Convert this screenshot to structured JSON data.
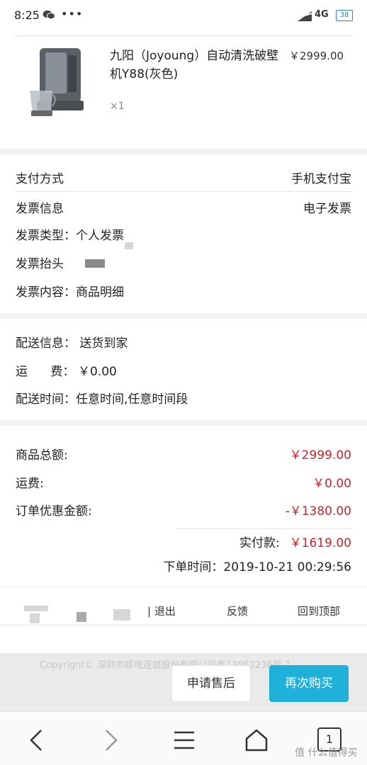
{
  "status_bar": {
    "time": "8:25",
    "more": "•••",
    "network": "4G",
    "battery": "38"
  },
  "product": {
    "name": "九阳（Joyoung）自动清洗破壁机Y88(灰色)",
    "price": "￥2999.00",
    "quantity": "×1"
  },
  "payment": {
    "method_label": "支付方式",
    "method_value": "手机支付宝"
  },
  "invoice": {
    "info_label": "发票信息",
    "info_value": "电子发票",
    "type": "发票类型：个人发票",
    "title_label": "发票抬头",
    "content": "发票内容：商品明细"
  },
  "delivery": {
    "info": "配送信息：  送货到家",
    "fee_label": "运      费：",
    "fee_value": "￥0.00",
    "time": "配送时间：任意时间,任意时间段"
  },
  "summary": {
    "goods_total_label": "商品总额:",
    "goods_total_value": "￥2999.00",
    "shipping_label": "运费:",
    "shipping_value": "￥0.00",
    "discount_label": "订单优惠金额:",
    "discount_value": "-￥1380.00",
    "paid_label": "实付款:",
    "paid_value": "￥1619.00",
    "order_time": "下单时间：2019-10-21 00:29:56"
  },
  "footer": {
    "logout": "| 退出",
    "feedback": "反馈",
    "back_to_top": "回到顶部",
    "copyright": "Copyright© 深圳市顺电连锁股份有限公司粤13052236号-1"
  },
  "actions": {
    "after_sale": "申请售后",
    "rebuy": "再次购买"
  },
  "browser_nav": {
    "tab_count": "1"
  },
  "watermark": "值 什么值得买",
  "colors": {
    "accent_red": "#c0282d",
    "rebuy_button": "#1fb1d9",
    "battery": "#2a7fd4"
  },
  "icons": [
    "wechat-icon",
    "signal-icon",
    "battery-icon",
    "back-arrow-icon",
    "forward-arrow-icon",
    "menu-icon",
    "home-icon",
    "tabs-icon"
  ]
}
